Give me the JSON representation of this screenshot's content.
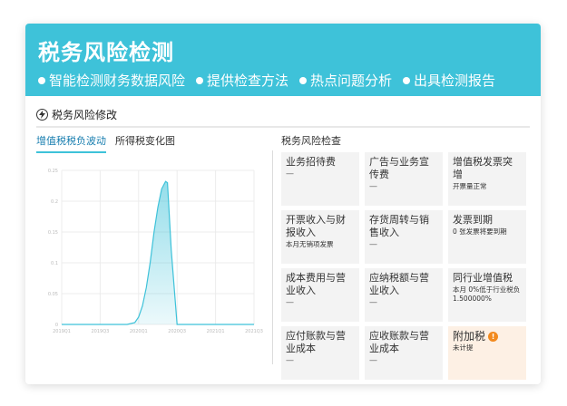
{
  "banner": {
    "title": "税务风险检测",
    "features": [
      "智能检测财务数据风险",
      "提供检查方法",
      "热点问题分析",
      "出具检测报告"
    ]
  },
  "section": {
    "title": "税务风险修改"
  },
  "tabs": [
    "增值税税负波动",
    "所得税变化图"
  ],
  "chart_data": {
    "type": "area",
    "x_tick_labels": [
      "2019Q1",
      "2019Q3",
      "2020Q1",
      "2020Q3",
      "2021Q1",
      "2021Q3"
    ],
    "y_tick_labels": [
      "0",
      "0.05",
      "0.1",
      "0.15",
      "0.2",
      "0.25"
    ],
    "ylim": [
      0,
      0.25
    ],
    "series": [
      {
        "x": [
          0,
          0.5,
          1,
          1.5,
          1.7,
          1.9,
          2,
          2.1,
          2.2,
          2.3,
          2.4,
          2.5,
          2.6,
          2.7,
          2.75,
          2.85,
          3,
          3.5,
          4,
          4.5,
          5
        ],
        "values": [
          0,
          0,
          0,
          0,
          0,
          0.003,
          0.012,
          0.03,
          0.06,
          0.1,
          0.15,
          0.19,
          0.22,
          0.232,
          0.23,
          0.12,
          0,
          0,
          0,
          0,
          0
        ]
      }
    ],
    "color": "#3ec2d9",
    "grid": true
  },
  "check": {
    "title": "税务风险检查",
    "items": [
      {
        "title": "业务招待费",
        "sub": "",
        "dash": "—"
      },
      {
        "title": "广告与业务宣传费",
        "sub": "",
        "dash": "—"
      },
      {
        "title": "增值税发票突增",
        "sub": "开票量正常",
        "dash": ""
      },
      {
        "title": "开票收入与财报收入",
        "sub": "本月无销项发票",
        "dash": ""
      },
      {
        "title": "存货周转与销售收入",
        "sub": "",
        "dash": "—"
      },
      {
        "title": "发票到期",
        "sub": "0 张发票将要到期",
        "dash": ""
      },
      {
        "title": "成本费用与营业收入",
        "sub": "",
        "dash": "—"
      },
      {
        "title": "应纳税额与营业收入",
        "sub": "",
        "dash": "—"
      },
      {
        "title": "同行业增值税",
        "sub": "本月 0%低于行业税负1.500000%",
        "dash": ""
      },
      {
        "title": "应付账款与营业成本",
        "sub": "",
        "dash": "—"
      },
      {
        "title": "应收账款与营业成本",
        "sub": "",
        "dash": "—"
      },
      {
        "title": "附加税",
        "sub": "未计提",
        "dash": "",
        "warn": "!"
      }
    ]
  }
}
